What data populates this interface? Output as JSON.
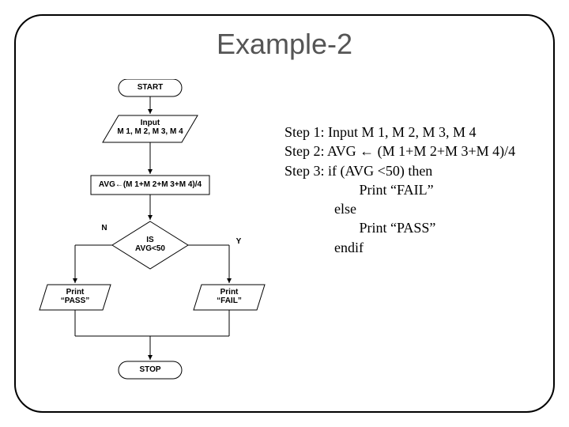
{
  "title": "Example-2",
  "flow": {
    "start": "START",
    "input_l1": "Input",
    "input_l2": "M 1, M 2, M 3, M 4",
    "process": "AVG←(M 1+M 2+M 3+M 4)/4",
    "decision_l1": "IS",
    "decision_l2": "AVG<50",
    "branch_n": "N",
    "branch_y": "Y",
    "pass_l1": "Print",
    "pass_l2": "“PASS”",
    "fail_l1": "Print",
    "fail_l2": "“FAIL”",
    "stop": "STOP"
  },
  "steps": {
    "s1": "Step 1:  Input M 1, M 2, M 3, M 4",
    "s2": "Step 2: AVG ← (M 1+M 2+M 3+M 4)/4",
    "s3": "Step 3:   if (AVG <50) then",
    "s3a": "                     Print “FAIL”",
    "s3b": "              else",
    "s3c": "                     Print “PASS”",
    "s3d": "              endif"
  },
  "chart_data": {
    "type": "flowchart",
    "nodes": [
      {
        "id": "start",
        "kind": "terminator",
        "label": "START"
      },
      {
        "id": "input",
        "kind": "io",
        "label": "Input M1, M2, M3, M4"
      },
      {
        "id": "proc",
        "kind": "process",
        "label": "AVG ← (M1+M2+M3+M4)/4"
      },
      {
        "id": "dec",
        "kind": "decision",
        "label": "IS AVG<50"
      },
      {
        "id": "pass",
        "kind": "io",
        "label": "Print \"PASS\""
      },
      {
        "id": "fail",
        "kind": "io",
        "label": "Print \"FAIL\""
      },
      {
        "id": "stop",
        "kind": "terminator",
        "label": "STOP"
      }
    ],
    "edges": [
      {
        "from": "start",
        "to": "input"
      },
      {
        "from": "input",
        "to": "proc"
      },
      {
        "from": "proc",
        "to": "dec"
      },
      {
        "from": "dec",
        "to": "pass",
        "label": "N"
      },
      {
        "from": "dec",
        "to": "fail",
        "label": "Y"
      },
      {
        "from": "pass",
        "to": "stop"
      },
      {
        "from": "fail",
        "to": "stop"
      }
    ]
  }
}
